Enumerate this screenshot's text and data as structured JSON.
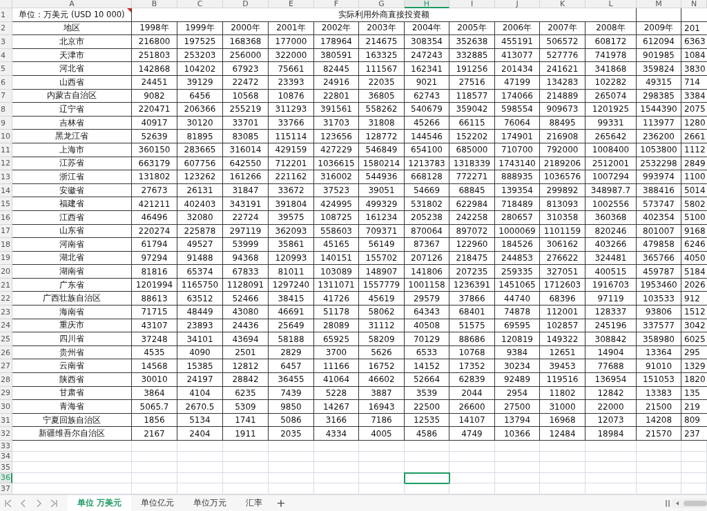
{
  "column_headers": [
    {
      "label": "A",
      "selected": false
    },
    {
      "label": "B",
      "selected": false
    },
    {
      "label": "C",
      "selected": false
    },
    {
      "label": "D",
      "selected": false
    },
    {
      "label": "E",
      "selected": false
    },
    {
      "label": "F",
      "selected": false
    },
    {
      "label": "G",
      "selected": false
    },
    {
      "label": "H",
      "selected": true
    },
    {
      "label": "I",
      "selected": false
    },
    {
      "label": "J",
      "selected": false
    },
    {
      "label": "K",
      "selected": false
    },
    {
      "label": "L",
      "selected": false
    },
    {
      "label": "M",
      "selected": false
    },
    {
      "label": "N",
      "selected": false
    }
  ],
  "row_headers": [
    {
      "label": "1",
      "selected": false
    },
    {
      "label": "2",
      "selected": false
    },
    {
      "label": "3",
      "selected": false
    },
    {
      "label": "4",
      "selected": false
    },
    {
      "label": "5",
      "selected": false
    },
    {
      "label": "6",
      "selected": false
    },
    {
      "label": "7",
      "selected": false
    },
    {
      "label": "8",
      "selected": false
    },
    {
      "label": "9",
      "selected": false
    },
    {
      "label": "10",
      "selected": false
    },
    {
      "label": "11",
      "selected": false
    },
    {
      "label": "12",
      "selected": false
    },
    {
      "label": "13",
      "selected": false
    },
    {
      "label": "14",
      "selected": false
    },
    {
      "label": "15",
      "selected": false
    },
    {
      "label": "16",
      "selected": false
    },
    {
      "label": "17",
      "selected": false
    },
    {
      "label": "18",
      "selected": false
    },
    {
      "label": "19",
      "selected": false
    },
    {
      "label": "20",
      "selected": false
    },
    {
      "label": "21",
      "selected": false
    },
    {
      "label": "22",
      "selected": false
    },
    {
      "label": "23",
      "selected": false
    },
    {
      "label": "24",
      "selected": false
    },
    {
      "label": "25",
      "selected": false
    },
    {
      "label": "26",
      "selected": false
    },
    {
      "label": "27",
      "selected": false
    },
    {
      "label": "28",
      "selected": false
    },
    {
      "label": "29",
      "selected": false
    },
    {
      "label": "30",
      "selected": false
    },
    {
      "label": "31",
      "selected": false
    },
    {
      "label": "32",
      "selected": false
    },
    {
      "label": "33",
      "selected": false
    },
    {
      "label": "34",
      "selected": false
    },
    {
      "label": "35",
      "selected": false
    },
    {
      "label": "36",
      "selected": true
    },
    {
      "label": "37",
      "selected": false
    }
  ],
  "title_row": {
    "unit": "单位：万美元 (USD 10 000)",
    "has_comment": true,
    "heading": "实际利用外商直接投资额"
  },
  "header_row": {
    "region": "地区",
    "years": [
      "1998年",
      "1999年",
      "2000年",
      "2001年",
      "2002年",
      "2003年",
      "2004年",
      "2005年",
      "2006年",
      "2007年",
      "2008年",
      "2009年",
      "201"
    ]
  },
  "rows": [
    {
      "region": "北京市",
      "values": [
        "216800",
        "197525",
        "168368",
        "177000",
        "178964",
        "214675",
        "308354",
        "352638",
        "455191",
        "506572",
        "608172",
        "612094",
        "6363"
      ]
    },
    {
      "region": "天津市",
      "values": [
        "251803",
        "253203",
        "256000",
        "322000",
        "380591",
        "163325",
        "247243",
        "332885",
        "413077",
        "527776",
        "741978",
        "901985",
        "1084"
      ]
    },
    {
      "region": "河北省",
      "values": [
        "142868",
        "104202",
        "67923",
        "75661",
        "82445",
        "111567",
        "162341",
        "191256",
        "201434",
        "241621",
        "341868",
        "359824",
        "3830"
      ]
    },
    {
      "region": "山西省",
      "values": [
        "24451",
        "39129",
        "22472",
        "23393",
        "24916",
        "22035",
        "9021",
        "27516",
        "47199",
        "134283",
        "102282",
        "49315",
        "714"
      ]
    },
    {
      "region": "内蒙古自治区",
      "values": [
        "9082",
        "6456",
        "10568",
        "10876",
        "22801",
        "36805",
        "62743",
        "118577",
        "174066",
        "214889",
        "265074",
        "298385",
        "3384"
      ]
    },
    {
      "region": "辽宁省",
      "values": [
        "220471",
        "206366",
        "255219",
        "311293",
        "391561",
        "558262",
        "540679",
        "359042",
        "598554",
        "909673",
        "1201925",
        "1544390",
        "2075"
      ]
    },
    {
      "region": "吉林省",
      "values": [
        "40917",
        "30120",
        "33701",
        "33766",
        "31703",
        "31808",
        "45266",
        "66115",
        "76064",
        "88495",
        "99331",
        "113977",
        "1280"
      ]
    },
    {
      "region": "黑龙江省",
      "values": [
        "52639",
        "81895",
        "83085",
        "115114",
        "123656",
        "128772",
        "144546",
        "152202",
        "174901",
        "216908",
        "265642",
        "236200",
        "2661"
      ]
    },
    {
      "region": "上海市",
      "values": [
        "360150",
        "283665",
        "316014",
        "429159",
        "427229",
        "546849",
        "654100",
        "685000",
        "710700",
        "792000",
        "1008400",
        "1053800",
        "1112"
      ]
    },
    {
      "region": "江苏省",
      "values": [
        "663179",
        "607756",
        "642550",
        "712201",
        "1036615",
        "1580214",
        "1213783",
        "1318339",
        "1743140",
        "2189206",
        "2512001",
        "2532298",
        "2849"
      ]
    },
    {
      "region": "浙江省",
      "values": [
        "131802",
        "123262",
        "161266",
        "221162",
        "316002",
        "544936",
        "668128",
        "772271",
        "888935",
        "1036576",
        "1007294",
        "993974",
        "1100"
      ]
    },
    {
      "region": "安徽省",
      "values": [
        "27673",
        "26131",
        "31847",
        "33672",
        "37523",
        "39051",
        "54669",
        "68845",
        "139354",
        "299892",
        "348987.7",
        "388416",
        "5014"
      ]
    },
    {
      "region": "福建省",
      "values": [
        "421211",
        "402403",
        "343191",
        "391804",
        "424995",
        "499329",
        "531802",
        "622984",
        "718489",
        "813093",
        "1002556",
        "573747",
        "5802"
      ]
    },
    {
      "region": "江西省",
      "values": [
        "46496",
        "32080",
        "22724",
        "39575",
        "108725",
        "161234",
        "205238",
        "242258",
        "280657",
        "310358",
        "360368",
        "402354",
        "5100"
      ]
    },
    {
      "region": "山东省",
      "values": [
        "220274",
        "225878",
        "297119",
        "362093",
        "558603",
        "709371",
        "870064",
        "897072",
        "1000069",
        "1101159",
        "820246",
        "801007",
        "9168"
      ]
    },
    {
      "region": "河南省",
      "values": [
        "61794",
        "49527",
        "53999",
        "35861",
        "45165",
        "56149",
        "87367",
        "122960",
        "184526",
        "306162",
        "403266",
        "479858",
        "6246"
      ]
    },
    {
      "region": "湖北省",
      "values": [
        "97294",
        "91488",
        "94368",
        "120993",
        "140151",
        "155702",
        "207126",
        "218475",
        "244853",
        "276622",
        "324481",
        "365766",
        "4050"
      ]
    },
    {
      "region": "湖南省",
      "values": [
        "81816",
        "65374",
        "67833",
        "81011",
        "103089",
        "148907",
        "141806",
        "207235",
        "259335",
        "327051",
        "400515",
        "459787",
        "5184"
      ]
    },
    {
      "region": "广东省",
      "values": [
        "1201994",
        "1165750",
        "1128091",
        "1297240",
        "1311071",
        "1557779",
        "1001158",
        "1236391",
        "1451065",
        "1712603",
        "1916703",
        "1953460",
        "2026"
      ]
    },
    {
      "region": "广西壮族自治区",
      "values": [
        "88613",
        "63512",
        "52466",
        "38415",
        "41726",
        "45619",
        "29579",
        "37866",
        "44740",
        "68396",
        "97119",
        "103533",
        "912"
      ]
    },
    {
      "region": "海南省",
      "values": [
        "71715",
        "48449",
        "43080",
        "46691",
        "51178",
        "58062",
        "64343",
        "68401",
        "74878",
        "112001",
        "128337",
        "93806",
        "1512"
      ]
    },
    {
      "region": "重庆市",
      "values": [
        "43107",
        "23893",
        "24436",
        "25649",
        "28089",
        "31112",
        "40508",
        "51575",
        "69595",
        "102857",
        "245196",
        "337577",
        "3042"
      ]
    },
    {
      "region": "四川省",
      "values": [
        "37248",
        "34101",
        "43694",
        "58188",
        "65925",
        "58209",
        "70129",
        "88686",
        "120819",
        "149322",
        "308842",
        "358980",
        "6025"
      ]
    },
    {
      "region": "贵州省",
      "values": [
        "4535",
        "4090",
        "2501",
        "2829",
        "3700",
        "5626",
        "6533",
        "10768",
        "9384",
        "12651",
        "14904",
        "13364",
        "295"
      ]
    },
    {
      "region": "云南省",
      "values": [
        "14568",
        "15385",
        "12812",
        "6457",
        "11166",
        "16752",
        "14152",
        "17352",
        "30234",
        "39453",
        "77688",
        "91010",
        "1329"
      ]
    },
    {
      "region": "陕西省",
      "values": [
        "30010",
        "24197",
        "28842",
        "36455",
        "41064",
        "46602",
        "52664",
        "62839",
        "92489",
        "119516",
        "136954",
        "151053",
        "1820"
      ]
    },
    {
      "region": "甘肃省",
      "values": [
        "3864",
        "4104",
        "6235",
        "7439",
        "5228",
        "3887",
        "3539",
        "2044",
        "2954",
        "11802",
        "12842",
        "13383",
        "135"
      ]
    },
    {
      "region": "青海省",
      "values": [
        "5065.7",
        "2670.5",
        "5309",
        "9850",
        "14267",
        "16943",
        "22500",
        "26600",
        "27500",
        "31000",
        "22000",
        "21500",
        "219"
      ]
    },
    {
      "region": "宁夏回族自治区",
      "values": [
        "1856",
        "5134",
        "1741",
        "5086",
        "3166",
        "7186",
        "12535",
        "14107",
        "13794",
        "16968",
        "12073",
        "14208",
        "809"
      ]
    },
    {
      "region": "新疆维吾尔自治区",
      "values": [
        "2167",
        "2404",
        "1911",
        "2035",
        "4334",
        "4005",
        "4586",
        "4749",
        "10366",
        "12484",
        "18984",
        "21570",
        "237"
      ]
    }
  ],
  "sheet_tabs": [
    {
      "label": "单位 万美元",
      "selected": true
    },
    {
      "label": "单位亿元",
      "selected": false
    },
    {
      "label": "单位万元",
      "selected": false
    },
    {
      "label": "汇率",
      "selected": false
    }
  ],
  "add_sheet_button": "+"
}
